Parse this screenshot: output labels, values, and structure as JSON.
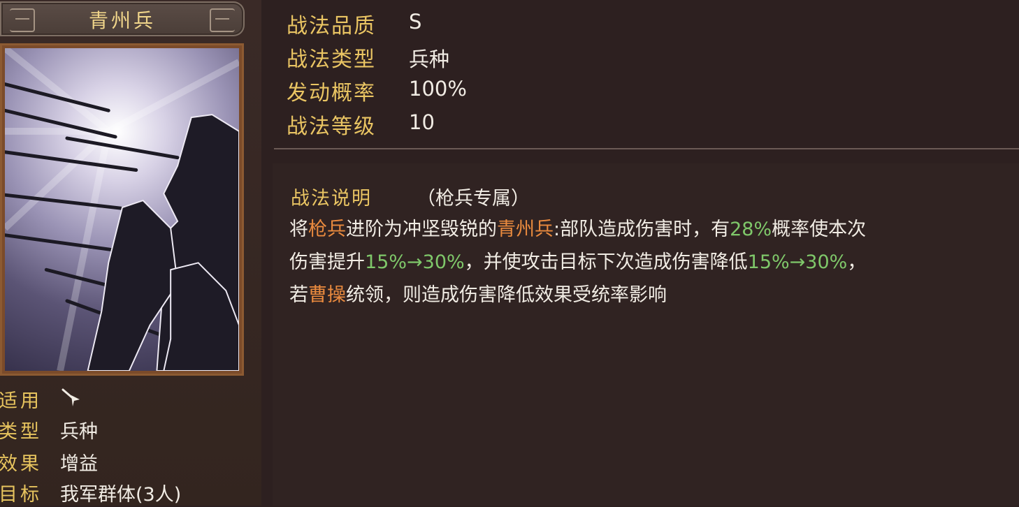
{
  "skill": {
    "name": "青州兵",
    "attributes": [
      {
        "label": "战法品质",
        "value": "S"
      },
      {
        "label": "战法类型",
        "value": "兵种"
      },
      {
        "label": "发动概率",
        "value": "100%"
      },
      {
        "label": "战法等级",
        "value": "10"
      }
    ],
    "info": [
      {
        "label": "适用",
        "value": ""
      },
      {
        "label": "类型",
        "value": "兵种"
      },
      {
        "label": "效果",
        "value": "增益"
      },
      {
        "label": "目标",
        "value": "我军群体(3人)"
      }
    ],
    "applicable_icon": "spear-icon",
    "description": {
      "title": "战法说明",
      "tag": "（枪兵专属）",
      "line1": [
        {
          "text": "将",
          "style": "normal"
        },
        {
          "text": "枪兵",
          "style": "orange"
        },
        {
          "text": "进阶为冲坚毁锐的",
          "style": "normal"
        },
        {
          "text": "青州兵",
          "style": "orange"
        },
        {
          "text": ":部队造成伤害时，有",
          "style": "normal"
        },
        {
          "text": "28%",
          "style": "green"
        },
        {
          "text": "概率使本次",
          "style": "normal"
        }
      ],
      "line2": [
        {
          "text": "伤害提升",
          "style": "normal"
        },
        {
          "text": "15%→30%",
          "style": "green"
        },
        {
          "text": "，并使攻击目标下次造成伤害降低",
          "style": "normal"
        },
        {
          "text": "15%→30%",
          "style": "green"
        },
        {
          "text": "，",
          "style": "normal"
        }
      ],
      "line3": [
        {
          "text": "若",
          "style": "normal"
        },
        {
          "text": "曹操",
          "style": "orange"
        },
        {
          "text": "统领，则造成伤害降低效果受统率影响",
          "style": "normal"
        }
      ]
    }
  },
  "colors": {
    "background": "#2d2020",
    "label_gold": "#eac563",
    "highlight_orange": "#e98a3e",
    "highlight_green": "#7fc86a"
  }
}
